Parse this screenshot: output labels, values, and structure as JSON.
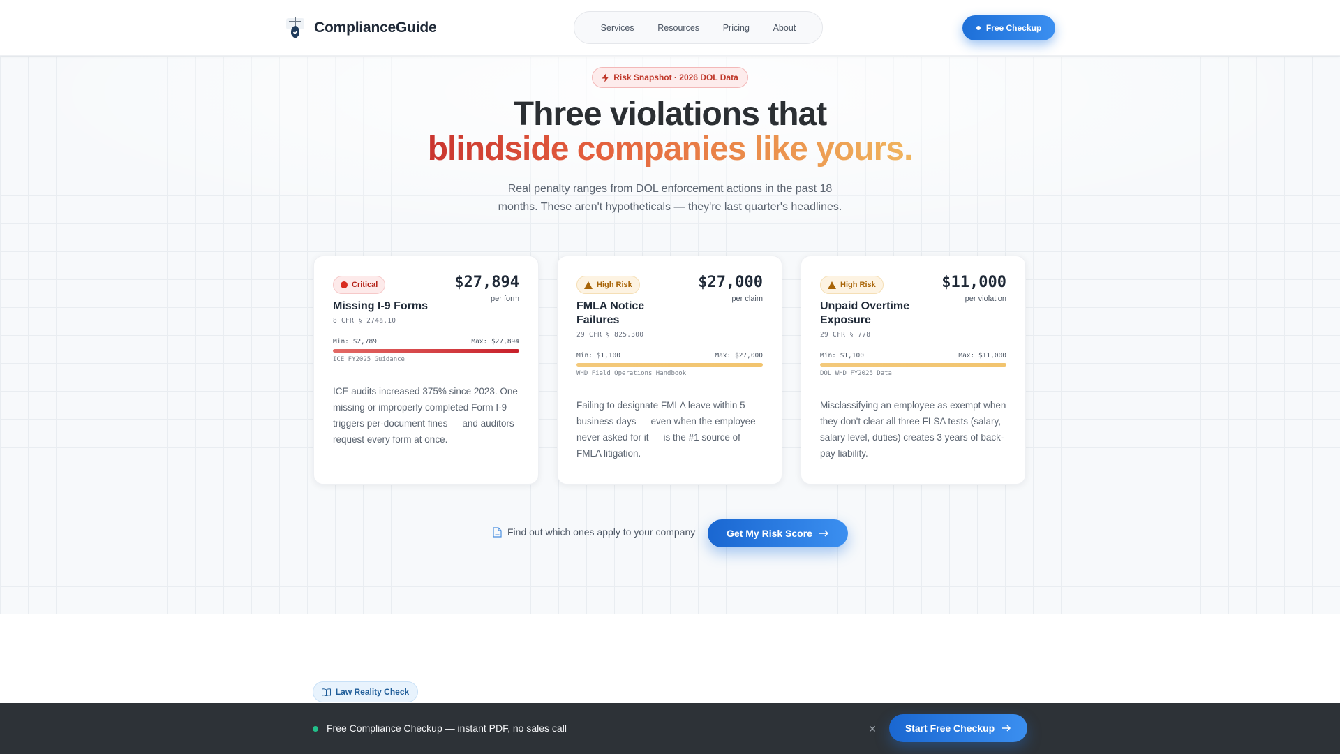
{
  "header": {
    "brand": "ComplianceGuide",
    "logo_icon": "shield-scale-logo",
    "nav": [
      "Services",
      "Resources",
      "Pricing",
      "About"
    ],
    "cta_label": "Free Checkup"
  },
  "hero": {
    "badge": "Risk Snapshot · 2026 DOL Data",
    "badge_icon": "lightning-icon",
    "headline_line1": "Three violations that",
    "headline_line2": "blindside companies like yours.",
    "subtitle": "Real penalty ranges from DOL enforcement actions in the past 18 months. These aren't hypotheticals — they're last quarter's headlines.",
    "cards": [
      {
        "badge": "Critical",
        "title": "Missing I-9 Forms",
        "cfr": "8 CFR § 274a.10",
        "amount": "$27,894",
        "unit": "per form",
        "min": "Min: $2,789",
        "max": "Max: $27,894",
        "source": "ICE FY2025 Guidance",
        "description": "ICE audits increased 375% since 2023. One missing or improperly completed Form I-9 triggers per-document fines — and auditors request every form at once."
      },
      {
        "badge": "High Risk",
        "title": "FMLA Notice Failures",
        "cfr": "29 CFR § 825.300",
        "amount": "$27,000",
        "unit": "per claim",
        "min": "Min: $1,100",
        "max": "Max: $27,000",
        "source": "WHD Field Operations Handbook",
        "description": "Failing to designate FMLA leave within 5 business days — even when the employee never asked for it — is the #1 source of FMLA litigation."
      },
      {
        "badge": "High Risk",
        "title": "Unpaid Overtime Exposure",
        "cfr": "29 CFR § 778",
        "amount": "$11,000",
        "unit": "per violation",
        "min": "Min: $1,100",
        "max": "Max: $11,000",
        "source": "DOL WHD FY2025 Data",
        "description": "Misclassifying an employee as exempt when they don't clear all three FLSA tests (salary, salary level, duties) creates 3 years of back-pay liability."
      }
    ],
    "cta_hint": "Find out which ones apply to your company",
    "cta_button": "Get My Risk Score"
  },
  "lower": {
    "badge": "Law Reality Check"
  },
  "bottom_bar": {
    "text": "Free Compliance Checkup — instant PDF, no sales call",
    "close_icon": "close-icon",
    "cta": "Start Free Checkup"
  },
  "colors": {
    "primary": "#1d6fd8",
    "critical": "#c8202a",
    "high_risk": "#f2c46e",
    "bottom_bar": "#2d3237"
  }
}
